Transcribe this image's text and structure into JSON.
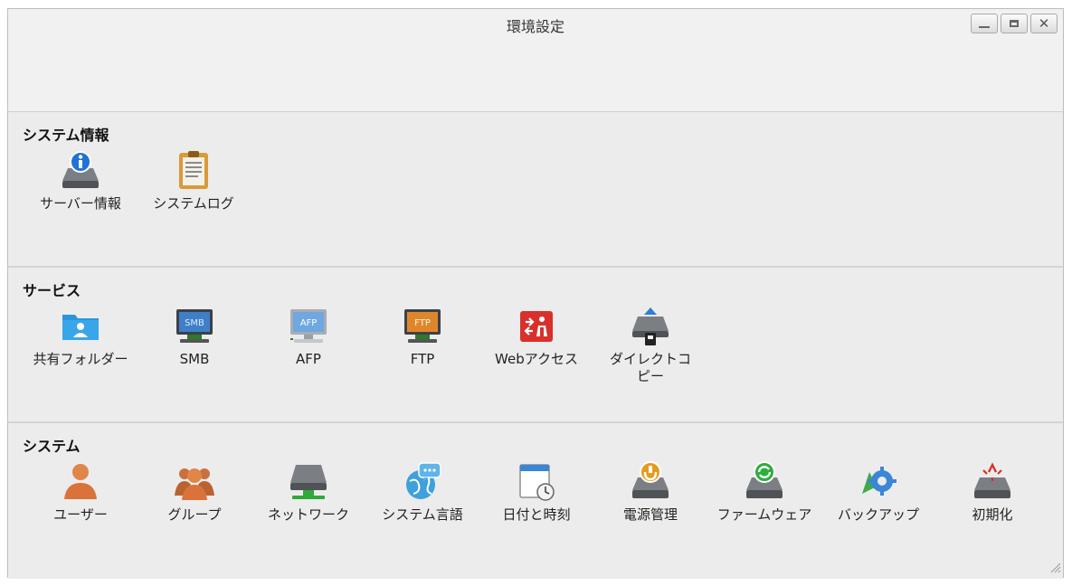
{
  "window": {
    "title": "環境設定"
  },
  "sections": [
    {
      "title": "システム情報",
      "items": [
        {
          "label": "サーバー情報",
          "icon": "server-info-icon"
        },
        {
          "label": "システムログ",
          "icon": "system-log-icon"
        }
      ]
    },
    {
      "title": "サービス",
      "items": [
        {
          "label": "共有フォルダー",
          "icon": "shared-folder-icon"
        },
        {
          "label": "SMB",
          "icon": "smb-icon",
          "badge": "SMB"
        },
        {
          "label": "AFP",
          "icon": "afp-icon",
          "badge": "AFP"
        },
        {
          "label": "FTP",
          "icon": "ftp-icon",
          "badge": "FTP"
        },
        {
          "label": "Webアクセス",
          "icon": "web-access-icon"
        },
        {
          "label": "ダイレクトコピー",
          "icon": "direct-copy-icon"
        }
      ]
    },
    {
      "title": "システム",
      "items": [
        {
          "label": "ユーザー",
          "icon": "user-icon"
        },
        {
          "label": "グループ",
          "icon": "group-icon"
        },
        {
          "label": "ネットワーク",
          "icon": "network-icon"
        },
        {
          "label": "システム言語",
          "icon": "language-icon"
        },
        {
          "label": "日付と時刻",
          "icon": "date-time-icon"
        },
        {
          "label": "電源管理",
          "icon": "power-icon"
        },
        {
          "label": "ファームウェア",
          "icon": "firmware-icon"
        },
        {
          "label": "バックアップ",
          "icon": "backup-icon"
        },
        {
          "label": "初期化",
          "icon": "initialize-icon"
        }
      ]
    }
  ]
}
